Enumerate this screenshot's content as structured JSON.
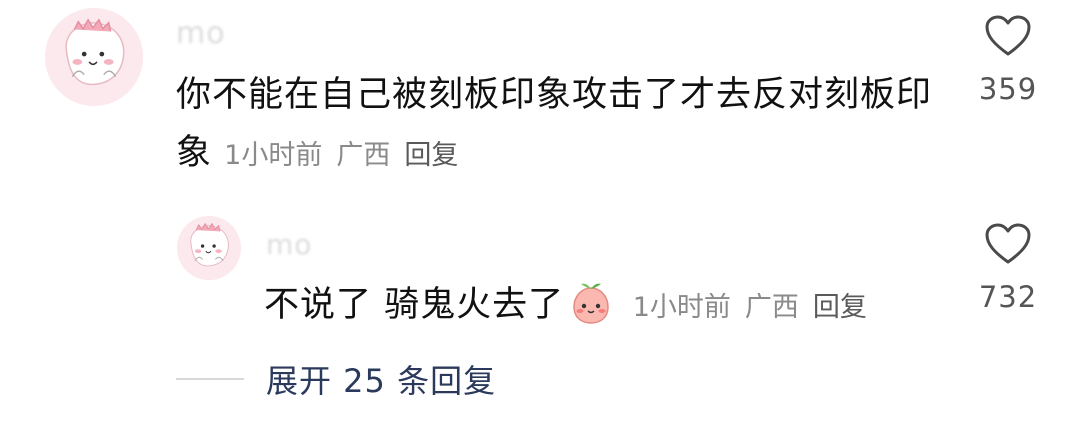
{
  "comment": {
    "username": "mo",
    "text": "你不能在自己被刻板印象攻击了才去反对刻板印象",
    "time": "1小时前",
    "location": "广西",
    "reply_label": "回复",
    "likes": "359",
    "avatar_icon": "pink-dinosaur-avatar-icon",
    "heart_icon": "heart-outline-icon"
  },
  "reply": {
    "username": "mo",
    "text": "不说了 骑鬼火去了",
    "emoji_icon": "peach-face-emoji-icon",
    "time": "1小时前",
    "location": "广西",
    "reply_label": "回复",
    "likes": "732",
    "avatar_icon": "pink-dinosaur-avatar-icon",
    "heart_icon": "heart-outline-icon"
  },
  "expand": {
    "label": "展开 25 条回复"
  },
  "colors": {
    "text": "#111111",
    "meta": "#8a8a8a",
    "expand": "#2b3a5c",
    "avatar_bg": "#fce9ee"
  }
}
